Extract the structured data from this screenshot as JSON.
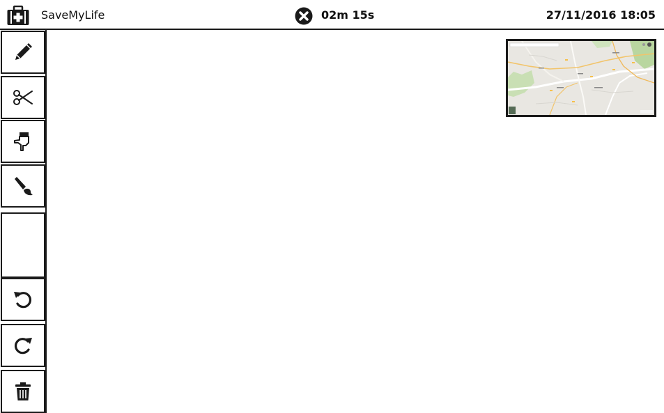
{
  "header": {
    "app_title": "SaveMyLife",
    "timer": "02m 15s",
    "datetime": "27/11/2016 18:05"
  },
  "icons": {
    "app": "first-aid-kit-icon",
    "close": "close-circle-icon"
  },
  "toolbar": {
    "tools": [
      {
        "name": "pencil",
        "icon": "pencil-icon"
      },
      {
        "name": "scissors",
        "icon": "scissors-icon"
      },
      {
        "name": "pointer",
        "icon": "pointing-hand-icon"
      },
      {
        "name": "brush",
        "icon": "paintbrush-icon"
      },
      {
        "name": "undo",
        "icon": "undo-icon"
      },
      {
        "name": "redo",
        "icon": "redo-icon"
      },
      {
        "name": "delete",
        "icon": "trash-icon"
      }
    ]
  },
  "colors": {
    "ink": "#1a1a1a",
    "map_background": "#e9e7e2",
    "map_park": "#b9d6a0",
    "map_road": "#f2c46a"
  }
}
